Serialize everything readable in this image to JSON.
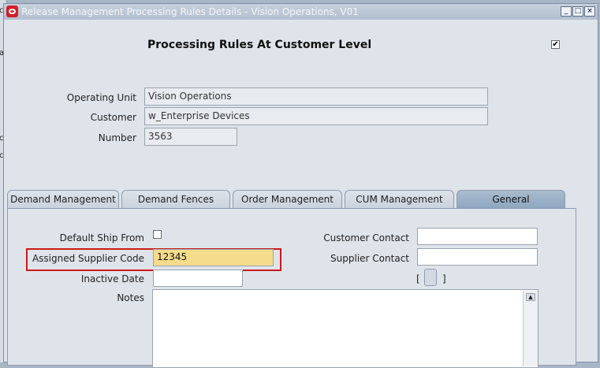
{
  "window": {
    "title": "Release Management Processing Rules Details - Vision Operations, V01"
  },
  "heading": "Processing Rules At Customer Level",
  "header_fields": [
    {
      "label": "Operating Unit",
      "value": "Vision Operations"
    },
    {
      "label": "Customer",
      "value": "w_Enterprise Devices"
    },
    {
      "label": "Number",
      "value": "3563"
    }
  ],
  "tabs": [
    {
      "label": "Demand Management",
      "active": false
    },
    {
      "label": "Demand Fences",
      "active": false
    },
    {
      "label": "Order Management",
      "active": false
    },
    {
      "label": "CUM Management",
      "active": false
    },
    {
      "label": "General",
      "active": true
    }
  ],
  "general": {
    "default_ship_from": {
      "label": "Default Ship From",
      "checked": false
    },
    "assigned_supplier_code": {
      "label": "Assigned Supplier Code",
      "value": "12345"
    },
    "inactive_date": {
      "label": "Inactive Date",
      "value": ""
    },
    "notes": {
      "label": "Notes",
      "value": ""
    },
    "customer_contact": {
      "label": "Customer Contact",
      "value": ""
    },
    "supplier_contact": {
      "label": "Supplier Contact",
      "value": ""
    },
    "dff": {
      "open": "[",
      "close": "]"
    }
  },
  "colors": {
    "highlight_border": "#cc1a1a",
    "active_field": "#f5dc8c",
    "active_tab": "#9fb4c9"
  }
}
